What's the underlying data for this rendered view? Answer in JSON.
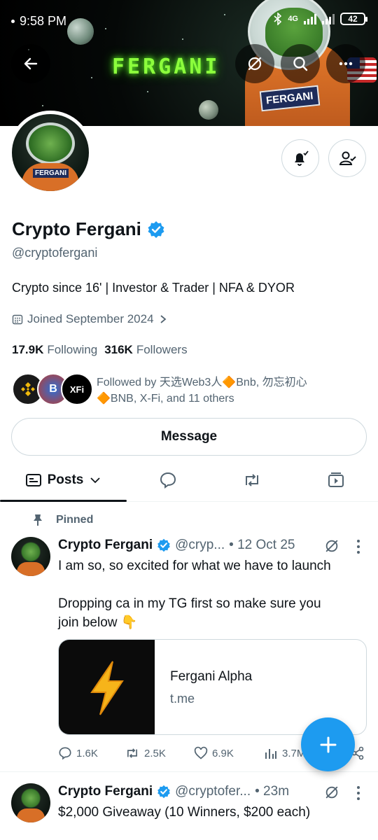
{
  "status_bar": {
    "time": "9:58 PM",
    "network": "4G",
    "battery": "42"
  },
  "banner": {
    "logo_text": "FERGANI",
    "patch_text": "FERGANI"
  },
  "profile": {
    "avatar_patch": "FERGANI",
    "name": "Crypto Fergani",
    "handle": "@cryptofergani",
    "bio": "Crypto since 16' | Investor & Trader | NFA & DYOR",
    "joined": "Joined September 2024",
    "following_count": "17.9K",
    "following_label": "Following",
    "followers_count": "316K",
    "followers_label": "Followers",
    "followed_by_line1": "Followed by 天选Web3人🔶Bnb, 勿忘初心",
    "followed_by_line2": "🔶BNB, X-Fi, and 11 others",
    "mini_avatar_labels": [
      "BINANCE",
      "B",
      "XFi"
    ]
  },
  "buttons": {
    "message": "Message"
  },
  "tabs": [
    {
      "label": "Posts"
    }
  ],
  "pinned_label": "Pinned",
  "posts": [
    {
      "name": "Crypto Fergani",
      "handle": "@cryp...",
      "time": "• 12 Oct 25",
      "text_line1": "I am so, so excited for what we have to launch",
      "text_line2": "Dropping ca in my TG first so make sure you",
      "text_line3": "join below 👇",
      "card_title": "Fergani Alpha",
      "card_domain": "t.me",
      "replies": "1.6K",
      "reposts": "2.5K",
      "likes": "6.9K",
      "views": "3.7M"
    },
    {
      "name": "Crypto Fergani",
      "handle": "@cryptofer...",
      "time": "• 23m",
      "text_line1": "$2,000 Giveaway (10 Winners, $200 each)"
    }
  ],
  "colors": {
    "accent": "#1d9bf0",
    "text": "#0f1419",
    "muted": "#536471",
    "border": "#cfd9de"
  }
}
